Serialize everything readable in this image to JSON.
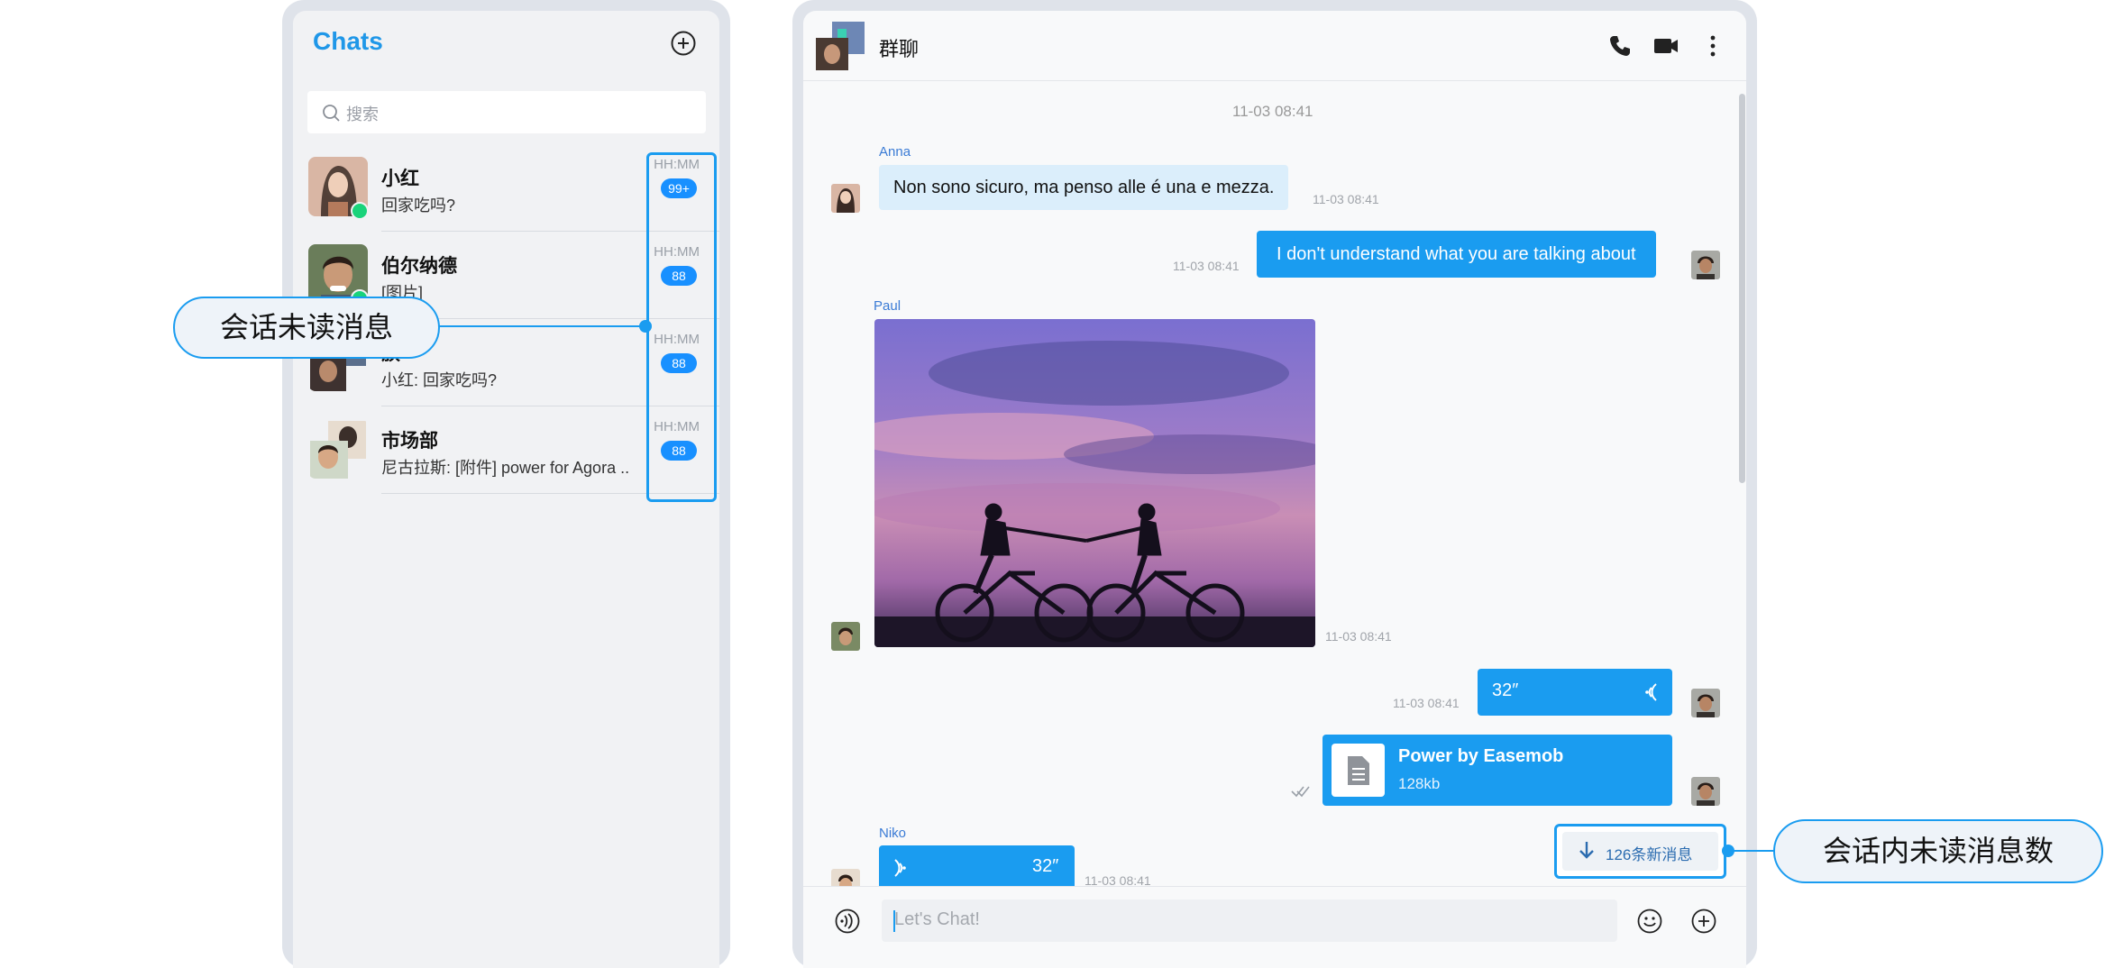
{
  "chat_list": {
    "title": "Chats",
    "search_placeholder": "搜索",
    "conversations": [
      {
        "name": "小红",
        "last_message": "回家吃吗?",
        "time": "HH:MM",
        "badge": "99+"
      },
      {
        "name": "伯尔纳德",
        "last_message": "[图片]",
        "time": "HH:MM",
        "badge": "88"
      },
      {
        "name": "族",
        "last_message": "小红: 回家吃吗?",
        "time": "HH:MM",
        "badge": "88"
      },
      {
        "name": "市场部",
        "last_message": "尼古拉斯: [附件] power for Agora ..",
        "time": "HH:MM",
        "badge": "88"
      }
    ]
  },
  "callouts": {
    "left": "会话未读消息",
    "right": "会话内未读消息数"
  },
  "chat": {
    "title": "群聊",
    "messages": {
      "center_time": "11-03 08:41",
      "anna_name": "Anna",
      "anna_text": "Non sono sicuro, ma penso alle é una e mezza.",
      "anna_time": "11-03 08:41",
      "out1_text": "I don't understand what you are talking about",
      "out1_time": "11-03 08:41",
      "paul_name": "Paul",
      "paul_time": "11-03 08:41",
      "voice_out_duration": "32″",
      "voice_out_time": "11-03 08:41",
      "file_name": "Power by Easemob",
      "file_size": "128kb",
      "niko_name": "Niko",
      "voice_in_duration": "32″",
      "voice_in_time": "11-03 08:41"
    },
    "new_messages_button": "126条新消息",
    "input_placeholder": "Let's Chat!"
  },
  "colors": {
    "accent": "#1a9cf0",
    "badge": "#1890ff",
    "online": "#19d37a",
    "incoming_bubble": "#dbeefb"
  },
  "icons": [
    "plus-icon",
    "search-icon",
    "phone-icon",
    "video-icon",
    "more-icon",
    "voice-icon",
    "emoji-icon",
    "file-icon",
    "arrow-down-icon",
    "read-check-icon"
  ]
}
